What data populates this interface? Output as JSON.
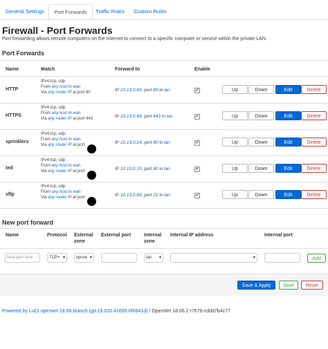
{
  "tabs": [
    "General Settings",
    "Port Forwards",
    "Traffic Rules",
    "Custom Rules"
  ],
  "page": {
    "title": "Firewall - Port Forwards",
    "description": "Port forwarding allows remote computers on the Internet to connect to a specific computer or service within the private LAN."
  },
  "port_forwards": {
    "heading": "Port Forwards",
    "columns": [
      "Name",
      "Match",
      "Forward to",
      "Enable"
    ],
    "rows": [
      {
        "name": "HTTP",
        "proto": "IPv4-tcp, udp",
        "from_pre": "From ",
        "from_host": "any host",
        "from_mid": " in ",
        "from_zone": "wan",
        "via_pre": "Via ",
        "via_router": "any router IP",
        "via_port": " at port 80",
        "fwd_pre": "IP ",
        "fwd_ip": "10.13.0.69",
        "fwd_mid": ", port ",
        "fwd_port": "80",
        "fwd_in": " in ",
        "fwd_zone": "lan"
      },
      {
        "name": "HTTPS",
        "proto": "IPv4-tcp, udp",
        "from_pre": "From ",
        "from_host": "any host",
        "from_mid": " in ",
        "from_zone": "wan",
        "via_pre": "Via ",
        "via_router": "any router IP",
        "via_port": " at port 443",
        "fwd_pre": "IP ",
        "fwd_ip": "10.13.0.69",
        "fwd_mid": ", port ",
        "fwd_port": "443",
        "fwd_in": " in ",
        "fwd_zone": "lan"
      },
      {
        "name": "sprinklers",
        "proto": "IPv4-tcp, udp",
        "from_pre": "From ",
        "from_host": "any host",
        "from_mid": " in ",
        "from_zone": "wan",
        "via_pre": "Via ",
        "via_router": "any router IP",
        "via_port": " at port",
        "fwd_pre": "IP ",
        "fwd_ip": "10.13.0.14",
        "fwd_mid": ", port ",
        "fwd_port": "80",
        "fwd_in": " in ",
        "fwd_zone": "lan"
      },
      {
        "name": "ted",
        "proto": "IPv4-tcp, udp",
        "from_pre": "From ",
        "from_host": "any host",
        "from_mid": " in ",
        "from_zone": "wan",
        "via_pre": "Via ",
        "via_router": "any router IP",
        "via_port": " at port",
        "fwd_pre": "IP ",
        "fwd_ip": "10.13.0.15",
        "fwd_mid": ", port ",
        "fwd_port": "80",
        "fwd_in": " in ",
        "fwd_zone": "lan"
      },
      {
        "name": "sftp",
        "proto": "IPv4-tcp, udp",
        "from_pre": "From ",
        "from_host": "any host",
        "from_mid": " in ",
        "from_zone": "wan",
        "via_pre": "Via ",
        "via_router": "any router IP",
        "via_port": " at port",
        "fwd_pre": "IP ",
        "fwd_ip": "10.13.0.69",
        "fwd_mid": ", port ",
        "fwd_port": "22",
        "fwd_in": " in ",
        "fwd_zone": "lan"
      }
    ],
    "buttons": {
      "up": "Up",
      "down": "Down",
      "edit": "Edit",
      "delete": "Delete"
    },
    "enable_mark": "✔"
  },
  "new_forward": {
    "heading": "New port forward",
    "col_name": "Name",
    "col_protocol": "Protocol",
    "col_ext_zone_1": "External",
    "col_ext_zone_2": "zone",
    "col_ext_port": "External port",
    "col_int_zone_1": "Internal",
    "col_int_zone_2": "zone",
    "col_int_ip": "Internal IP address",
    "col_int_port": "Internal port",
    "name_placeholder": "New port forw",
    "protocol_value": "TCP+",
    "ext_zone_value": "vpnse",
    "int_zone_value": "lan",
    "add_label": "Add"
  },
  "actions": {
    "save_apply": "Save & Apply",
    "save": "Save",
    "reset": "Reset"
  },
  "footer": {
    "powered": "Powered by LuCI openwrt-18.06 branch (git-19.020.41695-6f6841d)",
    "version": " / OpenWrt 18.06.2 r7676-cddd7b4c77"
  },
  "icons": {
    "checkbox": "check-icon",
    "select_arrow": "chevron-down-icon"
  }
}
